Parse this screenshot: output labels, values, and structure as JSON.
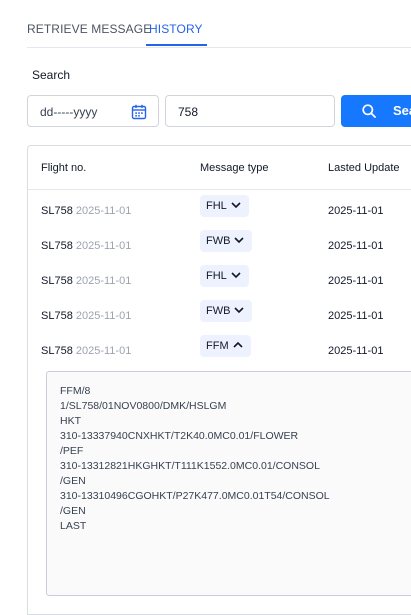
{
  "tabs": [
    {
      "label": "RETRIEVE MESSAGE",
      "active": false
    },
    {
      "label": "HISTORY",
      "active": true
    }
  ],
  "search": {
    "label": "Search",
    "date_placeholder": "dd-----yyyy",
    "flight_value": "758",
    "button_label": "Sea"
  },
  "table": {
    "headers": [
      "Flight no.",
      "Message type",
      "Lasted Update"
    ],
    "rows": [
      {
        "flight": "SL758",
        "date": "2025-11-01",
        "type": "FHL",
        "expanded": false,
        "updated": "2025-11-01"
      },
      {
        "flight": "SL758",
        "date": "2025-11-01",
        "type": "FWB",
        "expanded": false,
        "updated": "2025-11-01"
      },
      {
        "flight": "SL758",
        "date": "2025-11-01",
        "type": "FHL",
        "expanded": false,
        "updated": "2025-11-01"
      },
      {
        "flight": "SL758",
        "date": "2025-11-01",
        "type": "FWB",
        "expanded": false,
        "updated": "2025-11-01"
      },
      {
        "flight": "SL758",
        "date": "2025-11-01",
        "type": "FFM",
        "expanded": true,
        "updated": "2025-11-01"
      }
    ]
  },
  "message": {
    "lines": [
      "FFM/8",
      "1/SL758/01NOV0800/DMK/HSLGM",
      "HKT",
      "310-13337940CNXHKT/T2K40.0MC0.01/FLOWER",
      "/PEF",
      "310-13312821HKGHKT/T111K1552.0MC0.01/CONSOL",
      "/GEN",
      "310-13310496CGOHKT/P27K477.0MC0.01T54/CONSOL",
      "/GEN",
      "LAST"
    ]
  },
  "colors": {
    "accent": "#2563eb",
    "button": "#1677ff",
    "tag_bg": "#eef2ff",
    "muted": "#9ca3af"
  }
}
